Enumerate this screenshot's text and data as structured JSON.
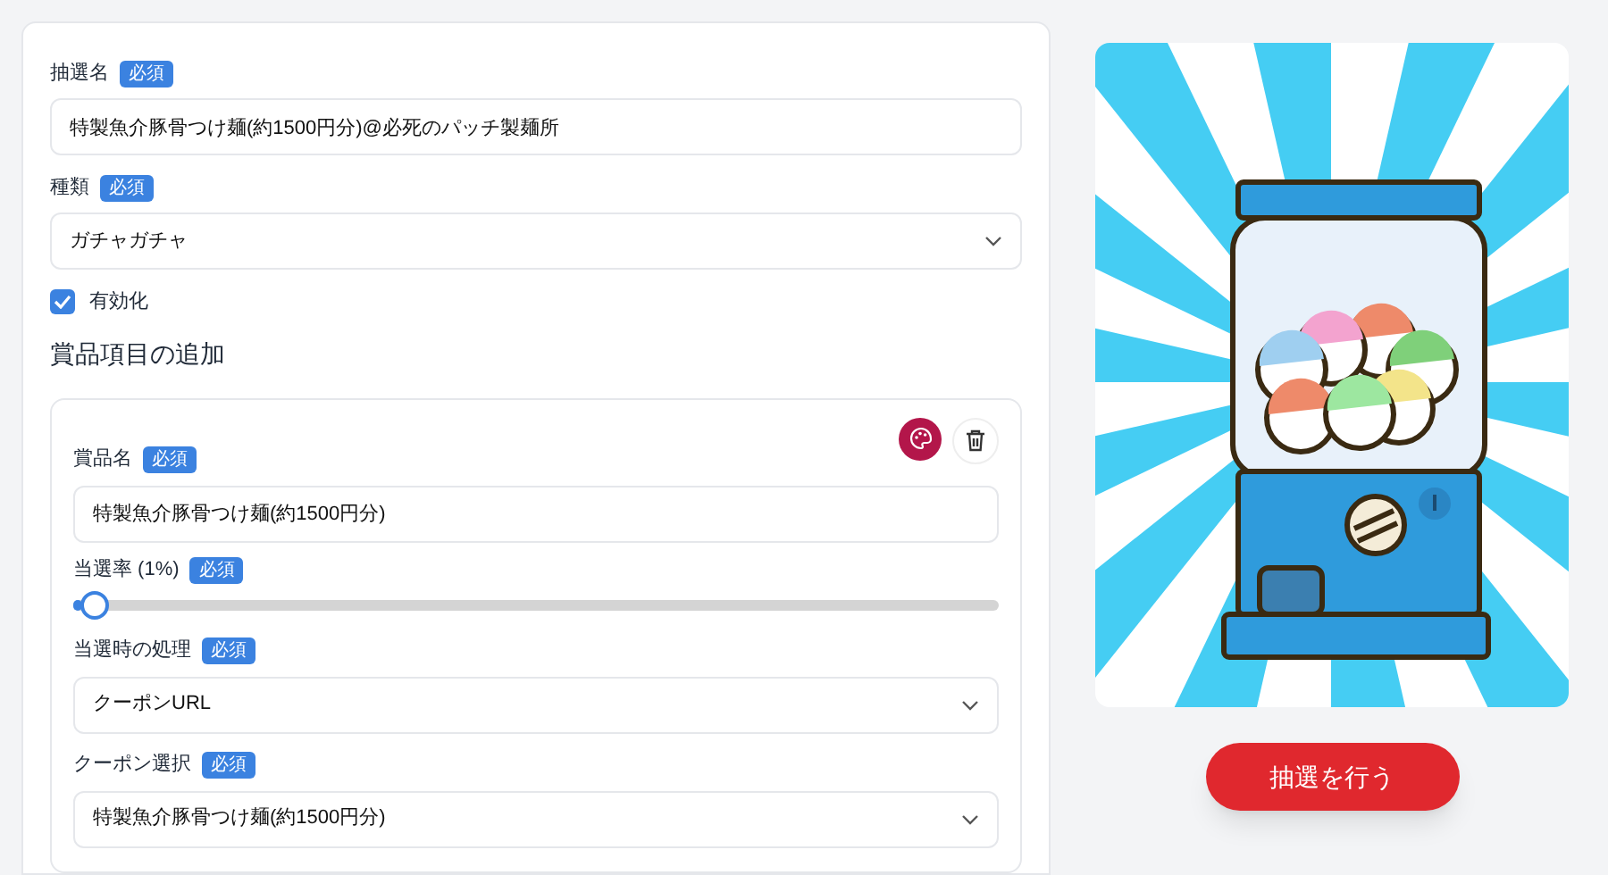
{
  "form": {
    "fields": [
      {
        "kind": "text",
        "label": "抽選名",
        "badge": "必須",
        "value": "特製魚介豚骨つけ麺(約1500円分)@必死のパッチ製麺所"
      },
      {
        "kind": "select",
        "label": "種類",
        "badge": "必須",
        "value": "ガチャガチャ"
      }
    ],
    "enabled": {
      "label": "有効化",
      "checked": true
    },
    "section_title": "賞品項目の追加",
    "prize": {
      "fields": [
        {
          "kind": "text",
          "label": "賞品名",
          "badge": "必須",
          "value": "特製魚介豚骨つけ麺(約1500円分)"
        },
        {
          "kind": "slider",
          "label": "当選率 (1%)",
          "badge": "必須",
          "level": 0.01
        },
        {
          "kind": "select",
          "label": "当選時の処理",
          "badge": "必須",
          "value": "クーポンURL"
        },
        {
          "kind": "select",
          "label": "クーポン選択",
          "badge": "必須",
          "value": "特製魚介豚骨つけ麺(約1500円分)"
        }
      ]
    }
  },
  "draw_button": "抽選を行う"
}
